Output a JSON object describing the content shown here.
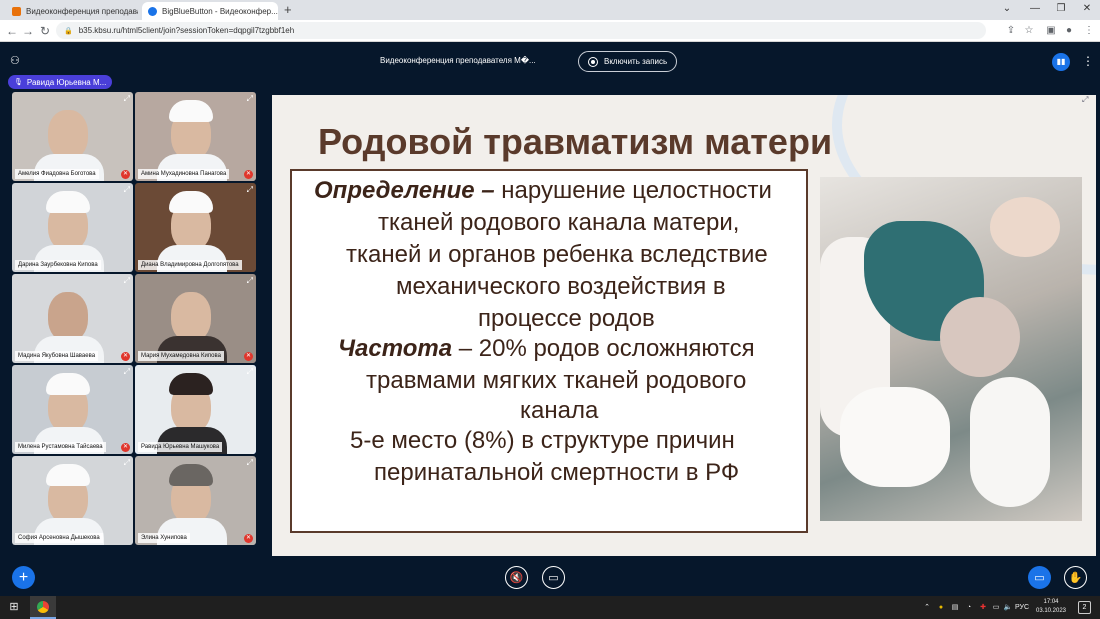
{
  "browser": {
    "tabs": [
      {
        "title": "Видеоконференция преподава...",
        "close": "×",
        "favicon_color": "#e8710a"
      },
      {
        "title": "BigBlueButton - Видеоконфер...",
        "close": "×",
        "favicon_color": "#1a73e8"
      }
    ],
    "new_tab": "+",
    "window_controls": {
      "dropdown": "⌄",
      "minimize": "—",
      "restore": "❐",
      "close": "✕"
    },
    "url": "b35.kbsu.ru/html5client/join?sessionToken=dqpgil7tzgbbf1eh"
  },
  "header": {
    "meeting_title": "Видеоконференция преподавателя М�...",
    "record_label": "Включить запись",
    "talking_user": "Равида Юрьевна М...",
    "accent_color": "#4a3fd9"
  },
  "videos": [
    {
      "name": "Амелия Фиадовна Боготова",
      "muted": true,
      "bg": "#c8c2bd"
    },
    {
      "name": "Амина Мухадиновна Панагова",
      "muted": true,
      "bg": "#b7a8a0"
    },
    {
      "name": "Дарина Заурбековна Кипова",
      "muted": false,
      "bg": "#d1d4d8"
    },
    {
      "name": "Диана Владимировна Долгопятова",
      "muted": false,
      "bg": "#6b4a36"
    },
    {
      "name": "Мадина Якубовна Шаваева",
      "muted": true,
      "bg": "#d6d8db"
    },
    {
      "name": "Мария Мухамедовна Кипова",
      "muted": true,
      "bg": "#9a8e86"
    },
    {
      "name": "Милена Рустамовна Тайсаева",
      "muted": true,
      "bg": "#c7ccd2"
    },
    {
      "name": "Равида Юрьевна Машукова",
      "muted": false,
      "bg": "#e8ecef"
    },
    {
      "name": "София Арсеновна Дышекова",
      "muted": false,
      "bg": "#d3d6d9"
    },
    {
      "name": "Элина Хунипова",
      "muted": true,
      "bg": "#b9b3ae"
    }
  ],
  "slide": {
    "title": "Родовой травматизм матери",
    "def_term": "Определение –",
    "def_line1": "нарушение целостности",
    "def_line2": "тканей родового канала матери,",
    "def_line3": "тканей и органов ребенка вследствие",
    "def_line4": "механического воздействия в",
    "def_line5": "процессе родов",
    "freq_term": "Частота",
    "freq_line1": "– 20% родов осложняются",
    "freq_line2": "травмами мягких тканей родового",
    "freq_line3": "канала",
    "rank_line1": "5-е место (8%) в структуре причин",
    "rank_line2": "перинатальной смертности в РФ"
  },
  "taskbar": {
    "lang": "РУС",
    "time": "17:04",
    "date": "03.10.2023",
    "notifications": "2"
  }
}
